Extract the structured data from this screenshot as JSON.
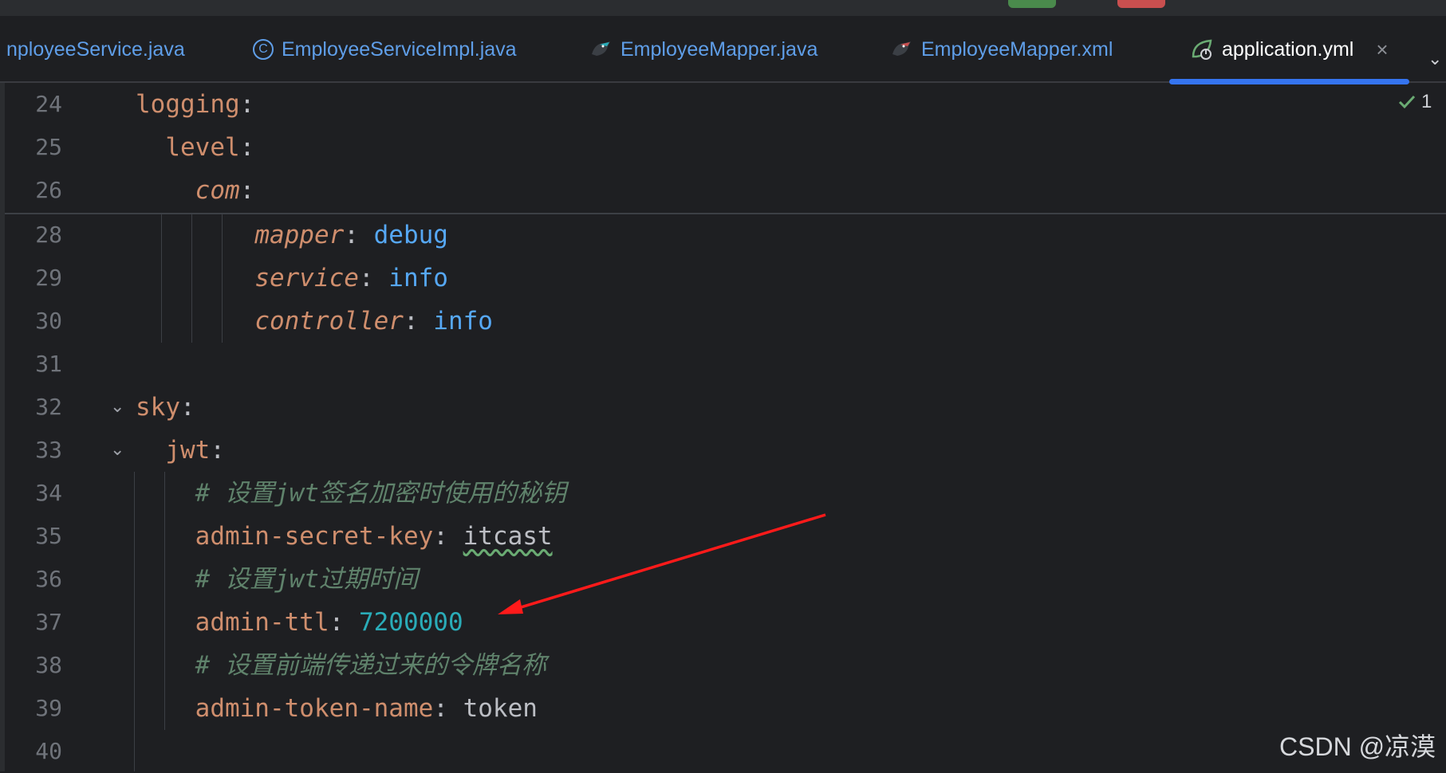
{
  "tabs": [
    {
      "label": "nployeeService.java",
      "icon": "java-class-icon"
    },
    {
      "label": "EmployeeServiceImpl.java",
      "icon": "class-c-icon"
    },
    {
      "label": "EmployeeMapper.java",
      "icon": "mybatis-bird-icon"
    },
    {
      "label": "EmployeeMapper.xml",
      "icon": "mybatis-bird-icon"
    },
    {
      "label": "application.yml",
      "icon": "spring-leaf-icon",
      "close": "×"
    }
  ],
  "inspection": {
    "count": "1"
  },
  "lines": [
    {
      "n": "24",
      "key": "logging",
      "sep": ":"
    },
    {
      "n": "25",
      "key": "level",
      "sep": ":"
    },
    {
      "n": "26",
      "key": "com",
      "sep": ":"
    },
    {
      "n": "28",
      "key": "mapper",
      "sep": ": ",
      "val": "debug"
    },
    {
      "n": "29",
      "key": "service",
      "sep": ": ",
      "val": "info"
    },
    {
      "n": "30",
      "key": "controller",
      "sep": ": ",
      "val": "info"
    },
    {
      "n": "31"
    },
    {
      "n": "32",
      "key": "sky",
      "sep": ":"
    },
    {
      "n": "33",
      "key": "jwt",
      "sep": ":"
    },
    {
      "n": "34",
      "comment": "# 设置jwt签名加密时使用的秘钥"
    },
    {
      "n": "35",
      "key": "admin-secret-key",
      "sep": ": ",
      "val": "itcast"
    },
    {
      "n": "36",
      "comment": "# 设置jwt过期时间"
    },
    {
      "n": "37",
      "key": "admin-ttl",
      "sep": ": ",
      "val": "7200000"
    },
    {
      "n": "38",
      "comment": "# 设置前端传递过来的令牌名称"
    },
    {
      "n": "39",
      "key": "admin-token-name",
      "sep": ": ",
      "val": "token"
    },
    {
      "n": "40"
    }
  ],
  "watermark": "CSDN @凉漠",
  "colors": {
    "accent": "#3574f0",
    "key": "#cf8e6d",
    "value": "#56a8f5",
    "number": "#2aacb8",
    "comment": "#5f826b",
    "arrow": "#ff1a1a"
  }
}
